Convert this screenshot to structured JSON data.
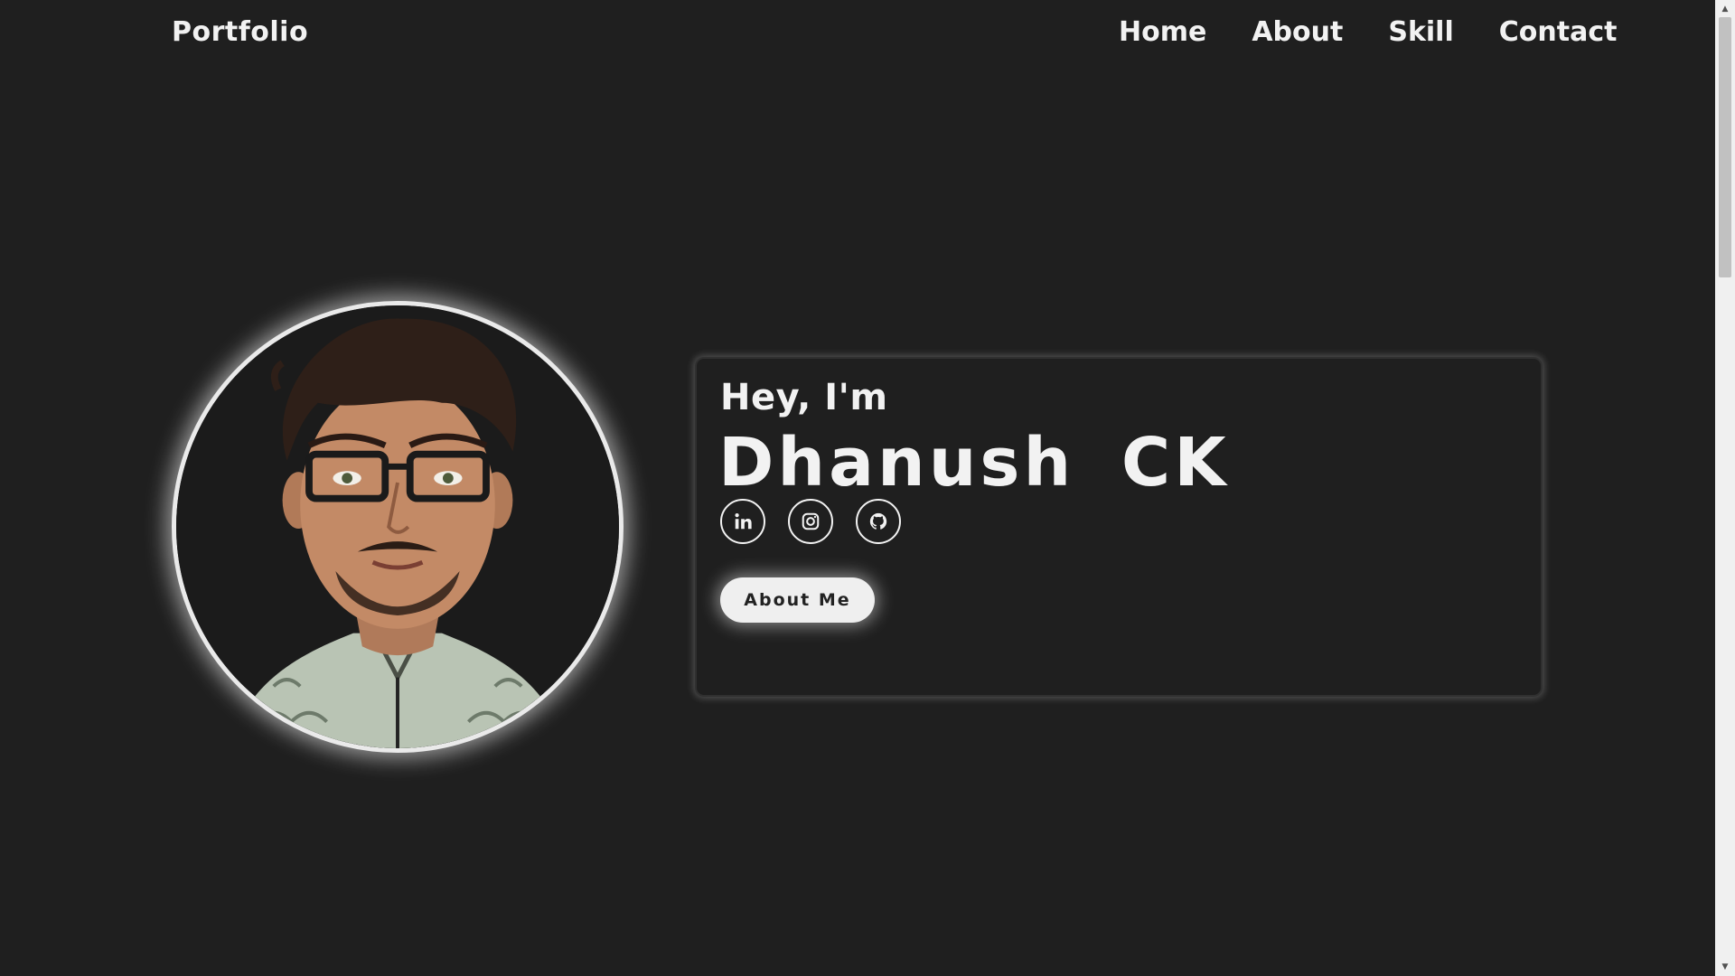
{
  "header": {
    "brand": "Portfolio",
    "nav": [
      "Home",
      "About",
      "Skill",
      "Contact"
    ]
  },
  "hero": {
    "greeting": "Hey, I'm",
    "name": "Dhanush CK",
    "socials": [
      {
        "name": "linkedin",
        "icon": "linkedin-icon"
      },
      {
        "name": "instagram",
        "icon": "instagram-icon"
      },
      {
        "name": "github",
        "icon": "github-icon"
      }
    ],
    "button_label": "About Me"
  },
  "scrollbar": {
    "up_glyph": "▲",
    "down_glyph": "▼"
  },
  "colors": {
    "background": "#1f1f1f",
    "text": "#f2f2f2",
    "button_bg": "#efefef",
    "button_text": "#222222"
  }
}
